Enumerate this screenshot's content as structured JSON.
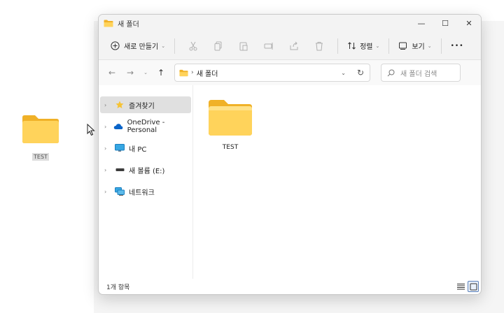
{
  "desktop": {
    "folder_label": "TEST"
  },
  "window": {
    "title": "새 폴더",
    "controls": {
      "minimize": "—",
      "maximize": "☐",
      "close": "✕"
    }
  },
  "toolbar": {
    "new_label": "새로 만들기",
    "sort_label": "정렬",
    "view_label": "보기",
    "more_label": "•••",
    "chevron": "⌄"
  },
  "address": {
    "back": "←",
    "forward": "→",
    "recent": "⌄",
    "up": "↑",
    "separator": "›",
    "path": "새 폴더",
    "dropdown": "⌄",
    "refresh": "↻",
    "search_placeholder": "새 폴더 검색"
  },
  "sidebar": {
    "items": [
      {
        "label": "즐겨찾기",
        "icon": "star-icon",
        "selected": true
      },
      {
        "label": "OneDrive - Personal",
        "icon": "cloud-icon",
        "selected": false
      },
      {
        "label": "내 PC",
        "icon": "monitor-icon",
        "selected": false
      },
      {
        "label": "새 볼륨 (E:)",
        "icon": "drive-icon",
        "selected": false
      },
      {
        "label": "네트워크",
        "icon": "network-icon",
        "selected": false
      }
    ],
    "expander": "›"
  },
  "content": {
    "files": [
      {
        "name": "TEST",
        "icon": "folder-icon"
      }
    ]
  },
  "status": {
    "count": "1개 항목"
  },
  "colors": {
    "folder_back": "#f2b631",
    "folder_front": "#ffd769",
    "accent": "#0067c0"
  }
}
